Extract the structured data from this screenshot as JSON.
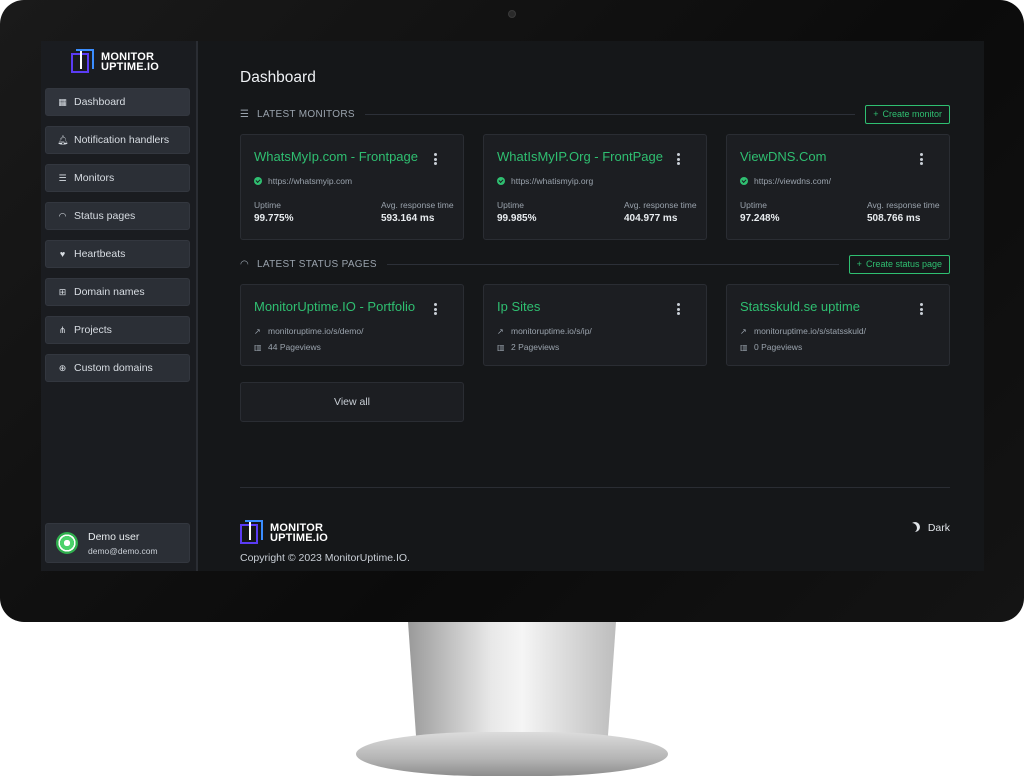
{
  "app": {
    "logo_line1": "MONITOR",
    "logo_line2": "UPTIME.IO"
  },
  "sidebar": {
    "items": [
      {
        "label": "Dashboard",
        "icon": "grid-icon"
      },
      {
        "label": "Notification handlers",
        "icon": "bell-icon"
      },
      {
        "label": "Monitors",
        "icon": "list-icon"
      },
      {
        "label": "Status pages",
        "icon": "wifi-icon"
      },
      {
        "label": "Heartbeats",
        "icon": "heart-pulse-icon"
      },
      {
        "label": "Domain names",
        "icon": "sitemap-icon"
      },
      {
        "label": "Projects",
        "icon": "project-diagram-icon"
      },
      {
        "label": "Custom domains",
        "icon": "globe-icon"
      }
    ],
    "user": {
      "name": "Demo user",
      "email": "demo@demo.com"
    }
  },
  "main": {
    "title": "Dashboard",
    "monitors_section": {
      "title": "LATEST MONITORS",
      "button": "Create monitor"
    },
    "monitors": [
      {
        "name": "WhatsMyIp.com - Frontpage",
        "url": "https://whatsmyip.com",
        "uptime_label": "Uptime",
        "uptime": "99.775%",
        "resp_label": "Avg. response time",
        "resp": "593.164 ms"
      },
      {
        "name": "WhatIsMyIP.Org - FrontPage",
        "url": "https://whatismyip.org",
        "uptime_label": "Uptime",
        "uptime": "99.985%",
        "resp_label": "Avg. response time",
        "resp": "404.977 ms"
      },
      {
        "name": "ViewDNS.Com",
        "url": "https://viewdns.com/",
        "uptime_label": "Uptime",
        "uptime": "97.248%",
        "resp_label": "Avg. response time",
        "resp": "508.766 ms"
      }
    ],
    "status_section": {
      "title": "LATEST STATUS PAGES",
      "button": "Create status page"
    },
    "status_pages": [
      {
        "name": "MonitorUptime.IO - Portfolio",
        "url": "monitoruptime.io/s/demo/",
        "views": "44 Pageviews"
      },
      {
        "name": "Ip Sites",
        "url": "monitoruptime.io/s/ip/",
        "views": "2 Pageviews"
      },
      {
        "name": "Statsskuld.se uptime",
        "url": "monitoruptime.io/s/statsskuld/",
        "views": "0 Pageviews"
      }
    ],
    "view_all": "View all"
  },
  "footer": {
    "copyright": "Copyright © 2023 MonitorUptime.IO.",
    "theme": "Dark"
  },
  "colors": {
    "accent_green": "#2fbf71",
    "logo_purple": "#5b3cf5",
    "logo_blue": "#3a8dff"
  }
}
